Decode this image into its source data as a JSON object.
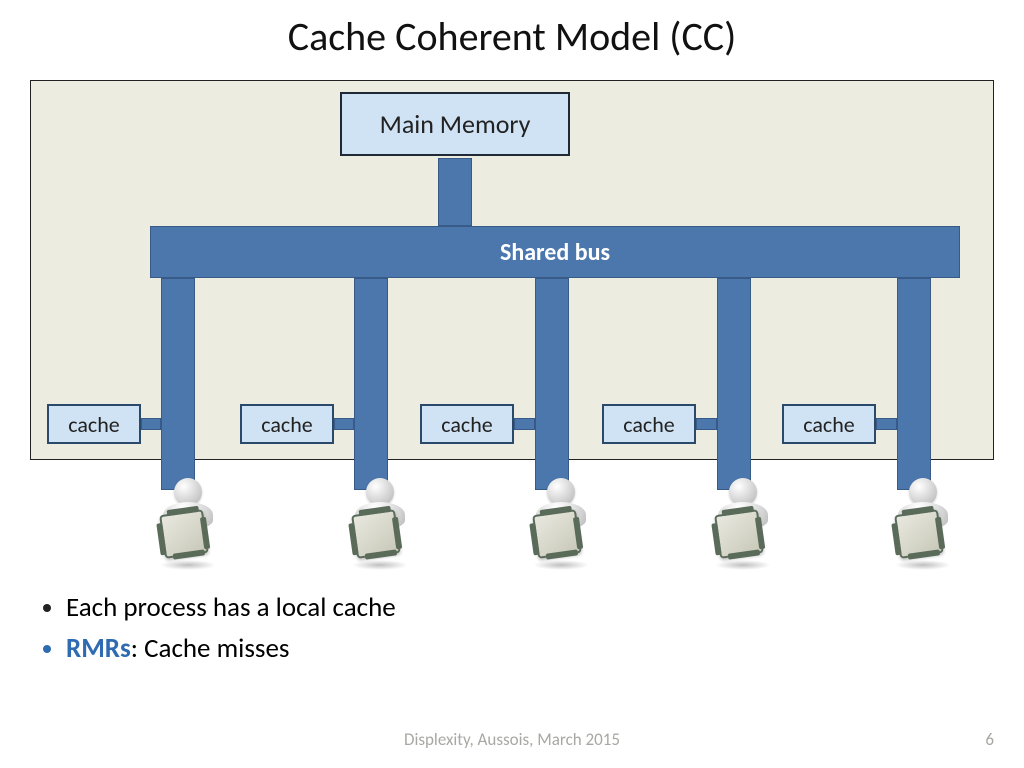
{
  "title": "Cache Coherent Model (CC)",
  "diagram": {
    "main_memory": "Main Memory",
    "shared_bus": "Shared bus",
    "caches": [
      "cache",
      "cache",
      "cache",
      "cache",
      "cache"
    ]
  },
  "bullets": {
    "b1": "Each process has a local cache",
    "b2_highlight": "RMRs",
    "b2_rest": ": Cache misses"
  },
  "footer": {
    "center": "Displexity, Aussois, March 2015",
    "page": "6"
  },
  "layout": {
    "drop_xs": [
      161,
      354,
      535,
      717,
      897
    ],
    "cache_xs": [
      47,
      240,
      420,
      602,
      782
    ],
    "proc_xs": [
      172,
      364,
      545,
      727,
      907
    ]
  }
}
